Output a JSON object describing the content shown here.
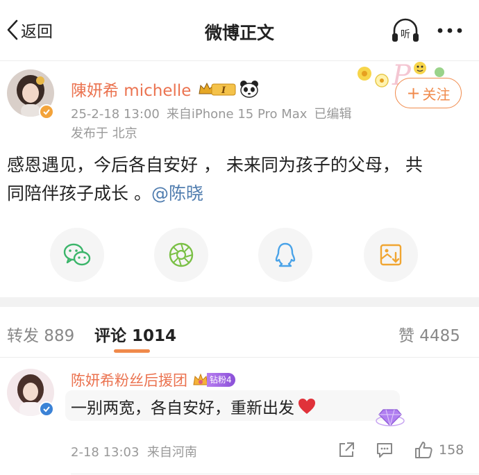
{
  "nav": {
    "back_label": "返回",
    "title": "微博正文",
    "listen_label": "听"
  },
  "post": {
    "author": "陳妍希 michelle",
    "crown_badge_text": "I",
    "date": "25-2-18 13:00",
    "source": "来自iPhone 15 Pro Max",
    "edited": "已编辑",
    "location": "发布于 北京",
    "follow_label": "关注",
    "text_part1": "感恩遇见，今后各自安好 ，  未来同为孩子的父母， 共同陪伴孩子成长 。",
    "mention": "@陈晓",
    "accent_color": "#eb7350",
    "follow_color": "#f08a4b",
    "link_color": "#507daf"
  },
  "share": {
    "items": [
      "wechat-icon",
      "moments-icon",
      "qq-icon",
      "save-image-icon"
    ]
  },
  "tabs": {
    "repost": "转发 889",
    "comment": "评论 1014",
    "like": "赞 4485"
  },
  "comment": {
    "author": "陈妍希粉丝后援团",
    "fan_badge": "钻粉4",
    "text": "一别两宽，各自安好，重新出发",
    "time": "2-18 13:03",
    "location": "来自河南",
    "like_count": "158"
  }
}
